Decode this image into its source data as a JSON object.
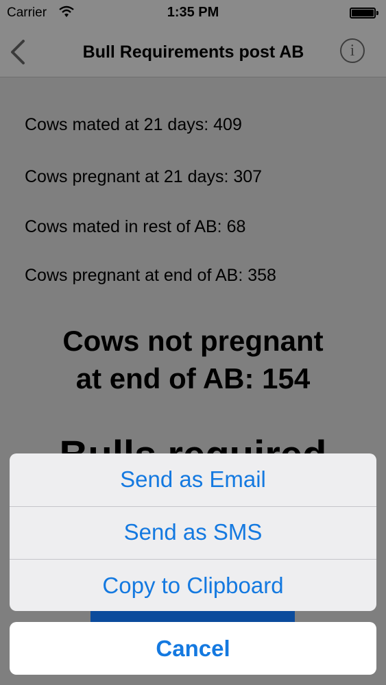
{
  "status_bar": {
    "carrier": "Carrier",
    "time": "1:35 PM"
  },
  "nav": {
    "title": "Bull Requirements post AB",
    "info_glyph": "i"
  },
  "stats": [
    "Cows mated at 21 days: 409",
    "Cows pregnant at 21 days: 307",
    "Cows mated in rest of AB: 68",
    "Cows pregnant at end of AB: 358"
  ],
  "summary": {
    "line1": "Cows not pregnant",
    "line2": "at end of AB: 154"
  },
  "bulls_heading": "Bulls required",
  "action_sheet": {
    "options": [
      "Send as Email",
      "Send as SMS",
      "Copy to Clipboard"
    ],
    "cancel": "Cancel"
  },
  "colors": {
    "accent": "#1479e0",
    "dim_background": "#7f7f7f",
    "primary_button": "#0b4b9c"
  },
  "icons": {
    "back": "chevron-left-icon",
    "info": "info-icon",
    "wifi": "wifi-icon",
    "battery": "battery-icon"
  }
}
